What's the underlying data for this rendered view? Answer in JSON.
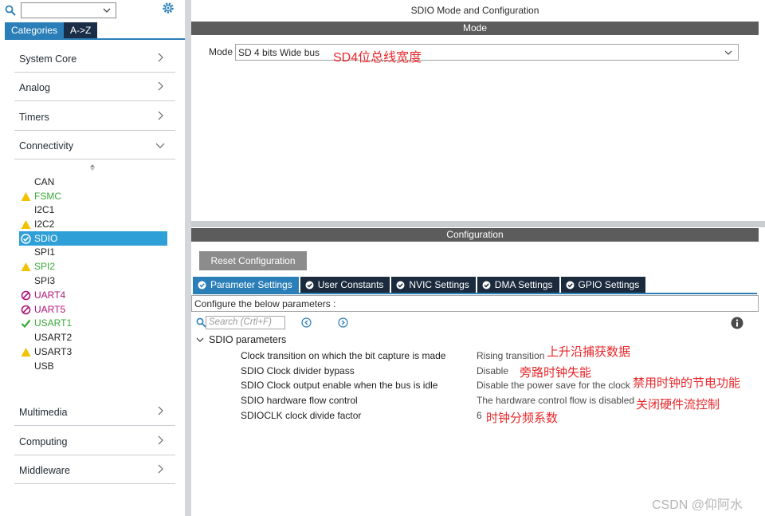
{
  "left_panel": {
    "tabs": [
      "Categories",
      "A->Z"
    ],
    "categories_top": [
      "System Core",
      "Analog",
      "Timers",
      "Connectivity"
    ],
    "connectivity_items": [
      {
        "label": "CAN",
        "status": "none"
      },
      {
        "label": "FSMC",
        "status": "warning"
      },
      {
        "label": "I2C1",
        "status": "none"
      },
      {
        "label": "I2C2",
        "status": "warning"
      },
      {
        "label": "SDIO",
        "status": "selected-ok"
      },
      {
        "label": "SPI1",
        "status": "none"
      },
      {
        "label": "SPI2",
        "status": "warning"
      },
      {
        "label": "SPI3",
        "status": "none"
      },
      {
        "label": "UART4",
        "status": "disabled"
      },
      {
        "label": "UART5",
        "status": "disabled"
      },
      {
        "label": "USART1",
        "status": "ok"
      },
      {
        "label": "USART2",
        "status": "none"
      },
      {
        "label": "USART3",
        "status": "warning"
      },
      {
        "label": "USB",
        "status": "none"
      }
    ],
    "categories_bottom": [
      "Multimedia",
      "Computing",
      "Middleware"
    ]
  },
  "window_title": "SDIO Mode and Configuration",
  "mode_section": {
    "header": "Mode",
    "label": "Mode",
    "value": "SD 4 bits Wide bus",
    "annotation": "SD4位总线宽度"
  },
  "config_section": {
    "header": "Configuration",
    "reset_button": "Reset Configuration",
    "tabs": [
      "Parameter Settings",
      "User Constants",
      "NVIC Settings",
      "DMA Settings",
      "GPIO Settings"
    ],
    "hint": "Configure the below parameters :",
    "search_placeholder": "Search (Crtl+F)",
    "group": "SDIO parameters",
    "params": [
      {
        "name": "Clock transition on which the bit capture is made",
        "value": "Rising transition",
        "annotation": "上升沿捕获数据"
      },
      {
        "name": "SDIO Clock divider bypass",
        "value": "Disable",
        "annotation": "旁路时钟失能"
      },
      {
        "name": "SDIO Clock output enable when the bus is idle",
        "value": "Disable the power save for the clock",
        "annotation": "禁用时钟的节电功能"
      },
      {
        "name": "SDIO hardware flow control",
        "value": "The hardware control flow is disabled",
        "annotation": "关闭硬件流控制"
      },
      {
        "name": "SDIOCLK clock divide factor",
        "value": "6",
        "annotation": "时钟分频系数"
      }
    ]
  },
  "watermark": "CSDN @仰阿水",
  "colors": {
    "accent": "#2b7fb8",
    "dark_tab": "#1b2a3d",
    "warning": "#f2c200",
    "ok": "#3aaa35",
    "disabled": "#b0157a",
    "annotation": "#e8262a"
  }
}
